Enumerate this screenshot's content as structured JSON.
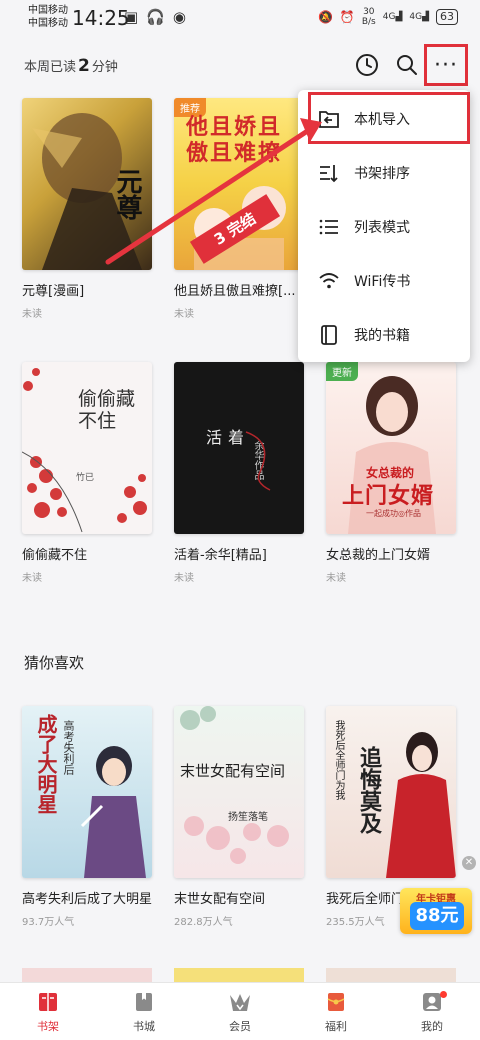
{
  "status_bar": {
    "carrier1": "中国移动",
    "carrier2": "中国移动",
    "time": "14:25",
    "net_speed": "30",
    "net_unit": "B/s",
    "signal1": "4G",
    "signal2": "4G",
    "battery": "63"
  },
  "header": {
    "weekly_prefix": "本周已读",
    "weekly_value": "2",
    "weekly_suffix": "分钟",
    "more_label": "···"
  },
  "bookshelf": [
    {
      "title": "元尊[漫画]",
      "status": "未读",
      "cover_text": "元尊",
      "colors": [
        "#c9a13a",
        "#3a2a18"
      ]
    },
    {
      "title": "他且娇且傲且难撩[...",
      "status": "未读",
      "tag": "推荐",
      "cover_text": "他且娇且傲且难撩",
      "badge": "3 完结",
      "colors": [
        "#f5d146",
        "#e95b3a"
      ]
    },
    {
      "title": "",
      "status": "",
      "colors": [
        "#e8e6ea",
        "#c8c4cc"
      ]
    },
    {
      "title": "偷偷藏不住",
      "status": "未读",
      "cover_text": "偷偷藏不住",
      "author": "竹已",
      "colors": [
        "#f8f4f4",
        "#d33a3a"
      ]
    },
    {
      "title": "活着-余华[精品]",
      "status": "未读",
      "cover_text": "活着",
      "author": "余华作品",
      "colors": [
        "#1a1a1a",
        "#111111"
      ]
    },
    {
      "title": "女总裁的上门女婿",
      "status": "未读",
      "tag": "更新",
      "cover_text": "上门女婿",
      "cover_text2": "女总裁的",
      "author": "一起成功◎作品",
      "colors": [
        "#fbe9e6",
        "#c91d20"
      ]
    }
  ],
  "section_title": "猜你喜欢",
  "recommendations": [
    {
      "title": "高考失利后成了大明星",
      "popularity": "93.7万人气",
      "cover_text": "成了大明星",
      "cover_text2": "高考失利后",
      "colors": [
        "#cfe7ef",
        "#6b4a84"
      ]
    },
    {
      "title": "末世女配有空间",
      "popularity": "282.8万人气",
      "cover_text": "末世女配有空间",
      "author": "扬笙落笔",
      "colors": [
        "#eaf3ee",
        "#f1d6d6"
      ]
    },
    {
      "title": "我死后全师门为我...",
      "popularity": "235.5万人气",
      "cover_text": "追悔莫及",
      "cover_text2": "我死后全师门为我",
      "colors": [
        "#f7f1ec",
        "#c8232b"
      ]
    }
  ],
  "menu": {
    "items": [
      {
        "label": "本机导入",
        "icon": "folder-import-icon"
      },
      {
        "label": "书架排序",
        "icon": "sort-icon"
      },
      {
        "label": "列表模式",
        "icon": "list-icon"
      },
      {
        "label": "WiFi传书",
        "icon": "wifi-icon"
      },
      {
        "label": "我的书籍",
        "icon": "book-icon"
      }
    ]
  },
  "promo": {
    "top": "年卡钜惠",
    "amount": "88元"
  },
  "nav": {
    "items": [
      {
        "label": "书架",
        "icon": "bookshelf-icon",
        "active": true
      },
      {
        "label": "书城",
        "icon": "bookstore-icon",
        "active": false
      },
      {
        "label": "会员",
        "icon": "vip-crown-icon",
        "active": false
      },
      {
        "label": "福利",
        "icon": "gift-envelope-icon",
        "active": false
      },
      {
        "label": "我的",
        "icon": "profile-icon",
        "active": false
      }
    ]
  },
  "colors": {
    "accent": "#e0303a",
    "background": "#f5f5f7"
  }
}
